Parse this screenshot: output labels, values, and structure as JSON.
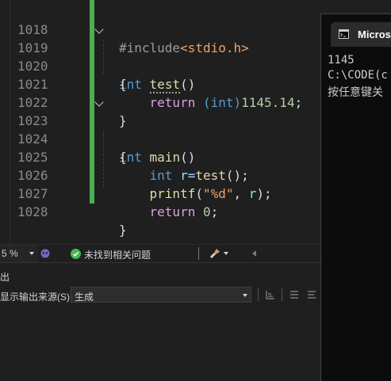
{
  "editor": {
    "lines": [
      {
        "n": "1018"
      },
      {
        "n": "1019"
      },
      {
        "n": "1020"
      },
      {
        "n": "1021"
      },
      {
        "n": "1022"
      },
      {
        "n": "1023"
      },
      {
        "n": "1024"
      },
      {
        "n": "1025"
      },
      {
        "n": "1026"
      },
      {
        "n": "1027"
      },
      {
        "n": "1028"
      }
    ],
    "tokens": {
      "include": "#include",
      "header": "<stdio.h>",
      "int": "int",
      "test": "test",
      "parens": "()",
      "brace_open": "{",
      "brace_close": "}",
      "return": "return",
      "cast": "(int)",
      "num": "1145.14",
      "semi": ";",
      "main": "main",
      "r_eq": "r=",
      "call_test": "test",
      "call_end": "();",
      "printf": "printf",
      "popen": "(",
      "fmt": "\"%d\"",
      "comma": ", ",
      "r": "r",
      "pclose": ");",
      "zero": "0"
    }
  },
  "statusbar": {
    "zoom": "5 %",
    "issues": "未找到相关问题"
  },
  "output_panel": {
    "title": "出",
    "source_label": "显示输出来源(S):",
    "source_value": "生成"
  },
  "console": {
    "tab_title": "Microso",
    "output_lines": [
      "1145",
      "C:\\CODE(c",
      "按任意键关"
    ]
  },
  "colors": {
    "change_bar": "#4caf50",
    "success": "#3fb950",
    "keyword": "#569cd6",
    "control": "#d8a0df",
    "function": "#dcdcaa"
  }
}
